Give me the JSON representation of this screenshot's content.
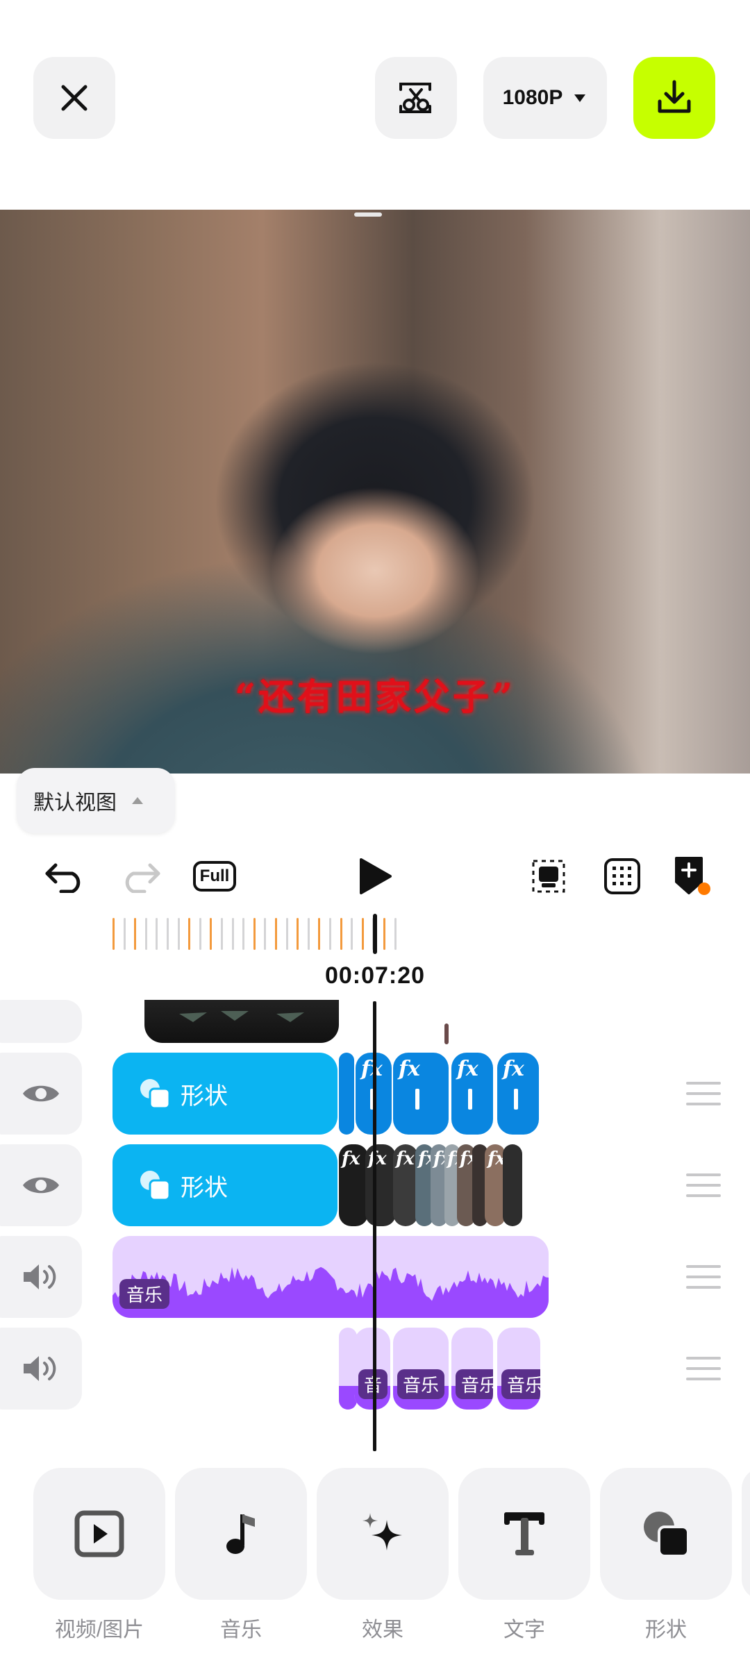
{
  "header": {
    "quality_label": "1080P",
    "accent_color": "#c6ff00"
  },
  "preview": {
    "subtitle": "“还有田家父子”"
  },
  "view_mode": {
    "label": "默认视图"
  },
  "playback": {
    "full_label": "Full",
    "timecode": "00:07:20"
  },
  "timeline": {
    "tracks": [
      {
        "type": "shape",
        "label": "形状",
        "visible_icon": "eye-icon"
      },
      {
        "type": "shape",
        "label": "形状",
        "visible_icon": "eye-icon"
      },
      {
        "type": "audio",
        "label": "音乐",
        "visible_icon": "speaker-icon"
      },
      {
        "type": "audio",
        "label": "音乐",
        "visible_icon": "speaker-icon"
      }
    ],
    "fx_label": "fx",
    "mini_audio_labels": [
      "音",
      "音乐",
      "音乐",
      "音乐"
    ],
    "colors": {
      "shape": "#0bb4f2",
      "audio_bg": "#e6d2ff",
      "audio_wave": "#9a49ff"
    }
  },
  "toolbar": {
    "items": [
      {
        "label": "视频/图片",
        "icon": "play-box-icon"
      },
      {
        "label": "音乐",
        "icon": "music-note-icon"
      },
      {
        "label": "效果",
        "icon": "sparkle-icon"
      },
      {
        "label": "文字",
        "icon": "text-icon"
      },
      {
        "label": "形状",
        "icon": "shape-icon"
      }
    ]
  }
}
